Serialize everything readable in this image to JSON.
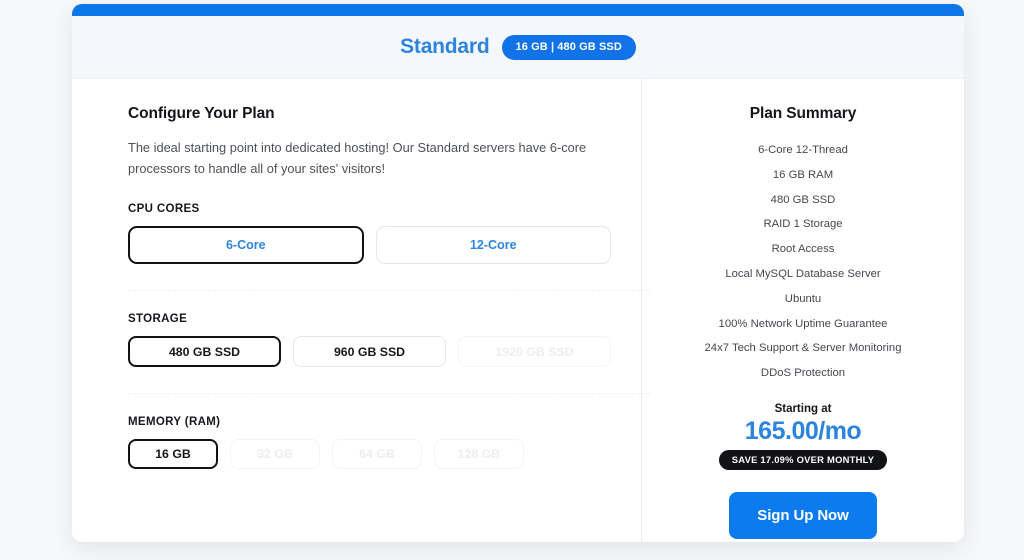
{
  "header": {
    "plan_name": "Standard",
    "plan_badge": "16 GB | 480 GB SSD"
  },
  "config": {
    "title": "Configure Your Plan",
    "description": "The ideal starting point into dedicated hosting! Our Standard servers have 6-core processors to handle all of your sites' visitors!",
    "groups": [
      {
        "label": "CPU CORES",
        "options": [
          {
            "label": "6-Core",
            "state": "selected"
          },
          {
            "label": "12-Core",
            "state": "available"
          }
        ]
      },
      {
        "label": "STORAGE",
        "options": [
          {
            "label": "480 GB SSD",
            "state": "selected"
          },
          {
            "label": "960 GB SSD",
            "state": "available"
          },
          {
            "label": "1920 GB SSD",
            "state": "disabled"
          }
        ]
      },
      {
        "label": "MEMORY (RAM)",
        "options": [
          {
            "label": "16 GB",
            "state": "selected"
          },
          {
            "label": "32 GB",
            "state": "disabled"
          },
          {
            "label": "64 GB",
            "state": "disabled"
          },
          {
            "label": "128 GB",
            "state": "disabled"
          }
        ]
      }
    ]
  },
  "summary": {
    "title": "Plan Summary",
    "items": [
      "6-Core 12-Thread",
      "16 GB RAM",
      "480 GB SSD",
      "RAID 1 Storage",
      "Root Access",
      "Local MySQL Database Server",
      "Ubuntu",
      "100% Network Uptime Guarantee",
      "24x7 Tech Support & Server Monitoring",
      "DDoS Protection"
    ],
    "starting_at_label": "Starting at",
    "price": "165.00/mo",
    "save_badge": "SAVE 17.09% OVER MONTHLY",
    "cta_label": "Sign Up Now"
  },
  "colors": {
    "accent_blue": "#0d7bf0",
    "title_blue": "#2d84dd",
    "badge_blue": "#1272e8",
    "dark": "#111215",
    "header_bg": "#f4f8fd"
  }
}
